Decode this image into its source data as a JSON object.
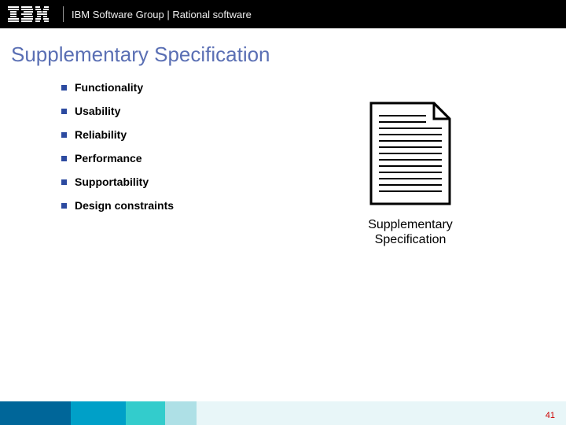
{
  "header": {
    "brand": "IBM",
    "subtitle": "IBM Software Group | Rational software"
  },
  "title": "Supplementary Specification",
  "bullets": [
    "Functionality",
    "Usability",
    "Reliability",
    "Performance",
    "Supportability",
    "Design constraints"
  ],
  "doc_caption_line1": "Supplementary",
  "doc_caption_line2": "Specification",
  "page_number": "41"
}
